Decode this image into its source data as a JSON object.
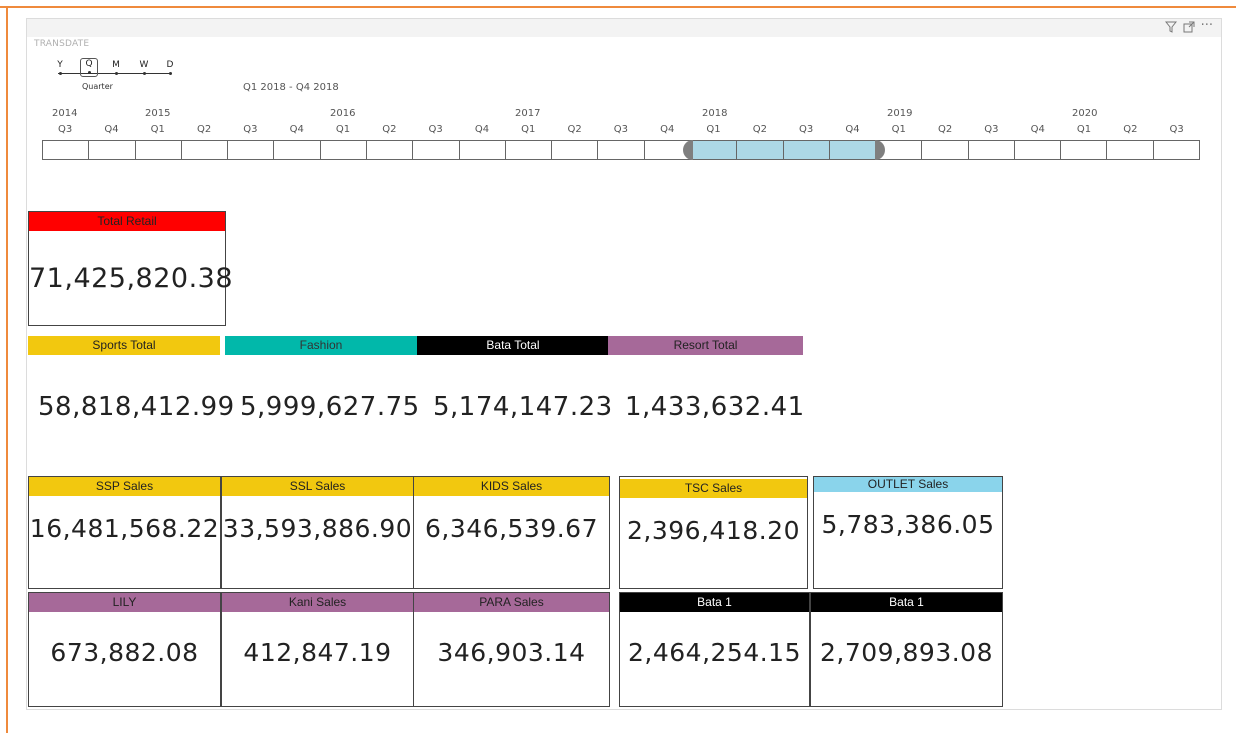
{
  "slicer": {
    "title": "TRANSDATE",
    "granularity": [
      {
        "label": "Y",
        "selected": false
      },
      {
        "label": "Q",
        "selected": true
      },
      {
        "label": "M",
        "selected": false
      },
      {
        "label": "W",
        "selected": false
      },
      {
        "label": "D",
        "selected": false
      }
    ],
    "granularity_caption": "Quarter",
    "range_text": "Q1 2018 - Q4 2018",
    "years": [
      "2014",
      "2015",
      "2016",
      "2017",
      "2018",
      "2019",
      "2020"
    ],
    "quarters": [
      "Q3",
      "Q4",
      "Q1",
      "Q2",
      "Q3",
      "Q4",
      "Q1",
      "Q2",
      "Q3",
      "Q4",
      "Q1",
      "Q2",
      "Q3",
      "Q4",
      "Q1",
      "Q2",
      "Q3",
      "Q4",
      "Q1",
      "Q2",
      "Q3",
      "Q4",
      "Q1",
      "Q2",
      "Q3"
    ],
    "selected_range": {
      "start": "Q1 2018",
      "end": "Q4 2018"
    }
  },
  "visual_icons": [
    "filter-icon",
    "focus-mode-icon",
    "more-options-icon"
  ],
  "total_retail": {
    "label": "Total Retail",
    "value": "71,425,820.38",
    "color": "#ff0000"
  },
  "categories": [
    {
      "label": "Sports Total",
      "value": "58,818,412.99",
      "color": "#f2c80f",
      "text_color": "#222222"
    },
    {
      "label": "Fashion",
      "value": "5,999,627.75",
      "color": "#01b8aa",
      "text_color": "#333333"
    },
    {
      "label": "Bata Total",
      "value": "5,174,147.23",
      "color": "#000000",
      "text_color": "#ffffff"
    },
    {
      "label": "Resort Total",
      "value": "1,433,632.41",
      "color": "#a66999",
      "text_color": "#222222"
    }
  ],
  "row1": [
    {
      "label": "SSP Sales",
      "value": "16,481,568.22",
      "color": "#f2c80f",
      "text_color": "#222222"
    },
    {
      "label": "SSL Sales",
      "value": "33,593,886.90",
      "color": "#f2c80f",
      "text_color": "#222222"
    },
    {
      "label": "KIDS Sales",
      "value": "6,346,539.67",
      "color": "#f2c80f",
      "text_color": "#222222"
    },
    {
      "label": "TSC Sales",
      "value": "2,396,418.20",
      "color": "#f2c80f",
      "text_color": "#222222"
    },
    {
      "label": "OUTLET  Sales",
      "value": "5,783,386.05",
      "color": "#8ad4eb",
      "text_color": "#222222"
    }
  ],
  "row2": [
    {
      "label": "LILY",
      "value": "673,882.08",
      "color": "#a66999",
      "text_color": "#222222"
    },
    {
      "label": "Kani Sales",
      "value": "412,847.19",
      "color": "#a66999",
      "text_color": "#222222"
    },
    {
      "label": "PARA Sales",
      "value": "346,903.14",
      "color": "#a66999",
      "text_color": "#222222"
    },
    {
      "label": "Bata 1",
      "value": "2,464,254.15",
      "color": "#000000",
      "text_color": "#ffffff"
    },
    {
      "label": "Bata 1",
      "value": "2,709,893.08",
      "color": "#000000",
      "text_color": "#ffffff"
    }
  ]
}
